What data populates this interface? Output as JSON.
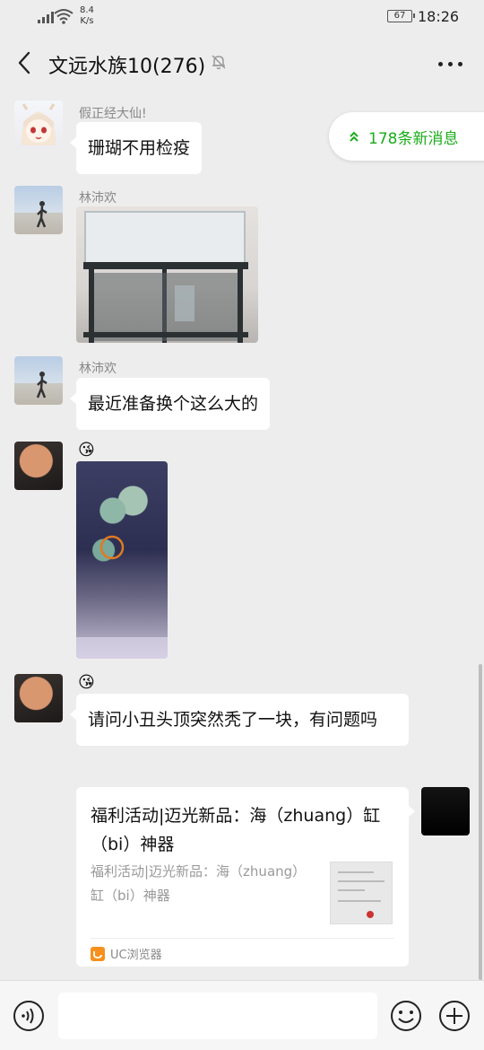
{
  "status_bar": {
    "speed_value": "8.4",
    "speed_unit": "K/s",
    "battery": "67",
    "time": "18:26"
  },
  "header": {
    "title": "文远水族10(276)"
  },
  "new_messages": {
    "label": "178条新消息",
    "color": "#1aad19"
  },
  "messages": [
    {
      "sender": "假正经大仙!",
      "type": "text",
      "text": "珊瑚不用检疫"
    },
    {
      "sender": "林沛欢",
      "type": "image",
      "image": "aquarium-stand-photo"
    },
    {
      "sender": "林沛欢",
      "type": "text",
      "text": "最近准备换个这么大的"
    },
    {
      "sender": "",
      "emoji": "😘",
      "type": "image",
      "image": "coral-photo"
    },
    {
      "sender": "",
      "emoji": "😘",
      "type": "text",
      "text": "请问小丑头顶突然秃了一块，有问题吗"
    }
  ],
  "link_card": {
    "title": "福利活动|迈光新品：海（zhuang）缸（bi）神器",
    "description": "福利活动|迈光新品：海（zhuang）缸（bi）神器",
    "source": "UC浏览器"
  },
  "colors": {
    "background": "#ededed",
    "bubble": "#ffffff",
    "accent": "#1aad19"
  }
}
